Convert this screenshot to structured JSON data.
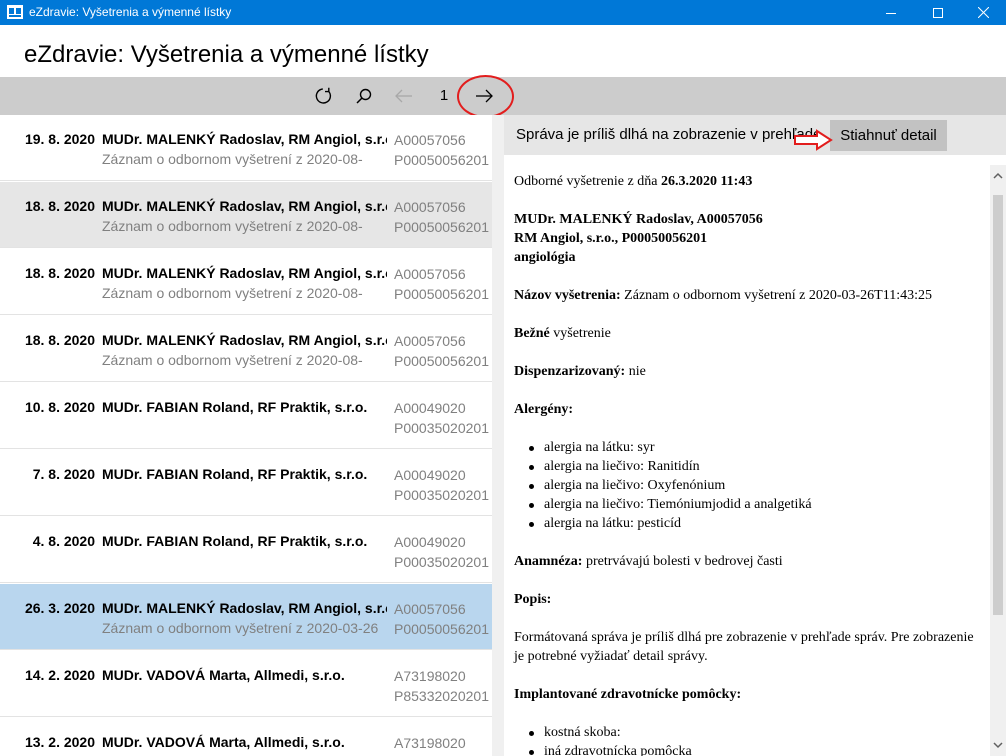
{
  "window": {
    "title": "eZdravie: Vyšetrenia a výmenné lístky",
    "accent_color": "#0078d7"
  },
  "header": {
    "title": "eZdravie: Vyšetrenia a výmenné lístky"
  },
  "toolbar": {
    "page_number": "1",
    "icons": [
      "refresh-icon",
      "search-icon",
      "arrow-left-icon",
      "arrow-right-icon"
    ]
  },
  "list": {
    "selected_index": 7,
    "rows": [
      {
        "date": "19. 8. 2020",
        "doctor": "MUDr. MALENKÝ Radoslav, RM Angiol, s.r.o.",
        "desc": "Záznam o odbornom vyšetrení z 2020-08-",
        "code1": "A00057056",
        "code2": "P00050056201"
      },
      {
        "date": "18. 8. 2020",
        "doctor": "MUDr. MALENKÝ Radoslav, RM Angiol, s.r.o.",
        "desc": "Záznam o odbornom vyšetrení z 2020-08-",
        "code1": "A00057056",
        "code2": "P00050056201"
      },
      {
        "date": "18. 8. 2020",
        "doctor": "MUDr. MALENKÝ Radoslav, RM Angiol, s.r.o.",
        "desc": "Záznam o odbornom vyšetrení z 2020-08-",
        "code1": "A00057056",
        "code2": "P00050056201"
      },
      {
        "date": "18. 8. 2020",
        "doctor": "MUDr. MALENKÝ Radoslav, RM Angiol, s.r.o.",
        "desc": "Záznam o odbornom vyšetrení z 2020-08-",
        "code1": "A00057056",
        "code2": "P00050056201"
      },
      {
        "date": "10. 8. 2020",
        "doctor": "MUDr. FABIAN Roland, RF Praktik, s.r.o.",
        "desc": "",
        "code1": "A00049020",
        "code2": "P00035020201"
      },
      {
        "date": "7. 8. 2020",
        "doctor": "MUDr. FABIAN Roland, RF Praktik, s.r.o.",
        "desc": "",
        "code1": "A00049020",
        "code2": "P00035020201"
      },
      {
        "date": "4. 8. 2020",
        "doctor": "MUDr. FABIAN Roland, RF Praktik, s.r.o.",
        "desc": "",
        "code1": "A00049020",
        "code2": "P00035020201"
      },
      {
        "date": "26. 3. 2020",
        "doctor": "MUDr. MALENKÝ Radoslav, RM Angiol, s.r.o.",
        "desc": "Záznam o odbornom vyšetrení z 2020-03-26",
        "code1": "A00057056",
        "code2": "P00050056201"
      },
      {
        "date": "14. 2. 2020",
        "doctor": "MUDr. VADOVÁ Marta, Allmedi, s.r.o.",
        "desc": "",
        "code1": "A73198020",
        "code2": "P85332020201"
      },
      {
        "date": "13. 2. 2020",
        "doctor": "MUDr. VADOVÁ Marta, Allmedi, s.r.o.",
        "desc": "",
        "code1": "A73198020",
        "code2": ""
      }
    ]
  },
  "notice": {
    "text": "Správa je príliš dlhá na zobrazenie v prehľade správ",
    "download_label": "Stiahnuť detail"
  },
  "detail": {
    "exam_prefix": "Odborné vyšetrenie z dňa ",
    "exam_date": "26.3.2020 11:43",
    "doctor_line": "MUDr. MALENKÝ Radoslav, A00057056",
    "facility_line": "RM Angiol, s.r.o., P00050056201",
    "specialty": "angiológia",
    "exam_name_label": "Názov vyšetrenia:",
    "exam_name_value": " Záznam o odbornom vyšetrení z 2020-03-26T11:43:25",
    "type_bold": "Bežné",
    "type_rest": " vyšetrenie",
    "dispensary_label": "Dispenzarizovaný:",
    "dispensary_value": " nie",
    "allergens_label": "Alergény:",
    "allergens": [
      "alergia na látku: syr",
      "alergia na liečivo: Ranitidín",
      "alergia na liečivo: Oxyfenónium",
      "alergia na liečivo: Tiemóniumjodid a analgetiká",
      "alergia na látku: pesticíd"
    ],
    "anamnesis_label": "Anamnéza:",
    "anamnesis_value": " pretrvávajú bolesti v bedrovej časti",
    "description_label": "Popis:",
    "formatted_note": "Formátovaná správa je príliš dlhá pre zobrazenie v prehľade správ. Pre zobrazenie je potrebné vyžiadať detail správy.",
    "implants_label": "Implantované zdravotnícke pomôcky:",
    "implants": [
      "kostná skoba:",
      "iná zdravotnícka pomôcka"
    ]
  },
  "colors": {
    "titlebar": "#0078d7",
    "toolbar": "#cccccc",
    "selected_row": "#b9d6ee",
    "hover_row": "#e6e6e6",
    "secondary_text": "#808080",
    "annotation_red": "#e21d1d",
    "download_button": "#c2c2c2"
  }
}
